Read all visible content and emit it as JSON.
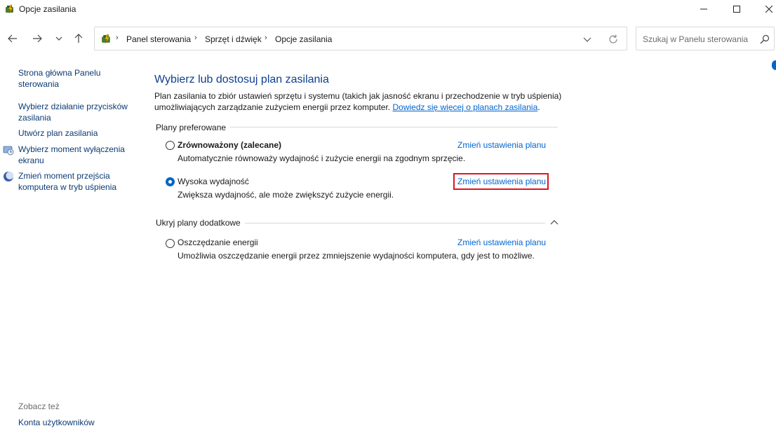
{
  "window": {
    "title": "Opcje zasilania",
    "icons": [
      "power-options-icon",
      "minimize-icon",
      "maximize-icon",
      "close-icon"
    ]
  },
  "nav": {
    "breadcrumb": [
      "Panel sterowania",
      "Sprzęt i dźwięk",
      "Opcje zasilania"
    ],
    "search_placeholder": "Szukaj w Panelu sterowania",
    "icons": [
      "back-arrow-icon",
      "forward-arrow-icon",
      "recent-chevron-icon",
      "up-arrow-icon",
      "dropdown-chevron-icon",
      "refresh-icon",
      "search-icon"
    ]
  },
  "sidebar": {
    "links": [
      "Strona główna Panelu sterowania",
      "Wybierz działanie przycisków zasilania",
      "Utwórz plan zasilania",
      "Wybierz moment wyłączenia ekranu",
      "Zmień moment przejścia komputera w tryb uśpienia"
    ],
    "see_also_label": "Zobacz też",
    "see_also_links": [
      "Konta użytkowników"
    ]
  },
  "main": {
    "title": "Wybierz lub dostosuj plan zasilania",
    "description": "Plan zasilania to zbiór ustawień sprzętu i systemu (takich jak jasność ekranu i przechodzenie w tryb uśpienia) umożliwiających zarządzanie zużyciem energii przez komputer.",
    "learn_more": "Dowiedz się więcej o planach zasilania",
    "preferred_header": "Plany preferowane",
    "additional_header": "Ukryj plany dodatkowe",
    "plans": [
      {
        "name": "Zrównoważony (zalecane)",
        "description": "Automatycznie równoważy wydajność i zużycie energii na zgodnym sprzęcie.",
        "link": "Zmień ustawienia planu",
        "selected": false
      },
      {
        "name": "Wysoka wydajność",
        "description": "Zwiększa wydajność, ale może zwiększyć zużycie energii.",
        "link": "Zmień ustawienia planu",
        "selected": true
      },
      {
        "name": "Oszczędzanie energii",
        "description": "Umożliwia oszczędzanie energii przez zmniejszenie wydajności komputera, gdy jest to możliwe.",
        "link": "Zmień ustawienia planu",
        "selected": false
      }
    ]
  },
  "colors": {
    "title_blue": "#0d3f8e",
    "link_blue": "#0065d1",
    "sidebar_link": "#0c3a73",
    "highlight_red": "#e0141e"
  }
}
